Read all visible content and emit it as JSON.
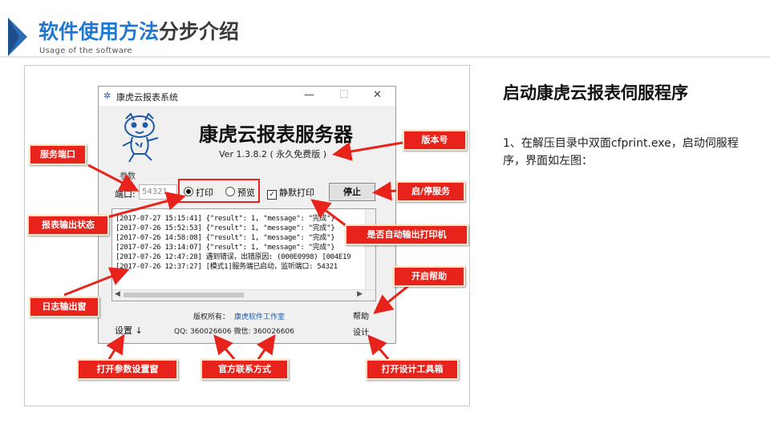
{
  "header": {
    "title_part1": "软件使用方法",
    "title_part2": "分步介绍",
    "subtitle": "Usage of the software"
  },
  "window": {
    "title": "康虎云报表系统",
    "app_name": "康虎云报表服务器",
    "version": "Ver 1.3.8.2 ( 永久免费版 )",
    "params_label": "参数",
    "port_label": "端口:",
    "port_value": "54321",
    "radio_print": "打印",
    "radio_preview": "预览",
    "silent_print": "静默打印",
    "stop_button": "停止",
    "log_lines": [
      "[2017-07-27 15:15:41] {\"result\": 1, \"message\": \"完成\"}",
      "[2017-07-26 15:52:53] {\"result\": 1, \"message\": \"完成\"}",
      "[2017-07-26 14:58:08] {\"result\": 1, \"message\": \"完成\"}",
      "[2017-07-26 13:14:07] {\"result\": 1, \"message\": \"完成\"}",
      "[2017-07-26 12:47:28] 遇到错误，出错原因: (000E0998) [004E19",
      "[2017-07-26 12:37:27] [模式1]服务端已启动，监听端口: 54321"
    ],
    "copyright_label": "版权所有：",
    "copyright_link": "康虎软件工作室",
    "contact": "QQ:  360026606    微信: 360026606",
    "settings": "设置 ↓",
    "help": "帮助",
    "design": "设计"
  },
  "annotations": {
    "service_port": "服务端口",
    "version_no": "版本号",
    "start_stop": "启/停服务",
    "output_state": "报表输出状态",
    "auto_print": "是否自动输出打印机",
    "log_window": "日志输出窗",
    "open_help": "开启帮助",
    "open_settings": "打开参数设置窗",
    "official_contact": "官方联系方式",
    "open_designer": "打开设计工具箱"
  },
  "right": {
    "title": "启动康虎云报表伺服程序",
    "body": "1、在解压目录中双面cfprint.exe，启动伺服程序，界面如左图："
  },
  "colors": {
    "accent": "#1f78d1",
    "annotation": "#e8231b"
  }
}
